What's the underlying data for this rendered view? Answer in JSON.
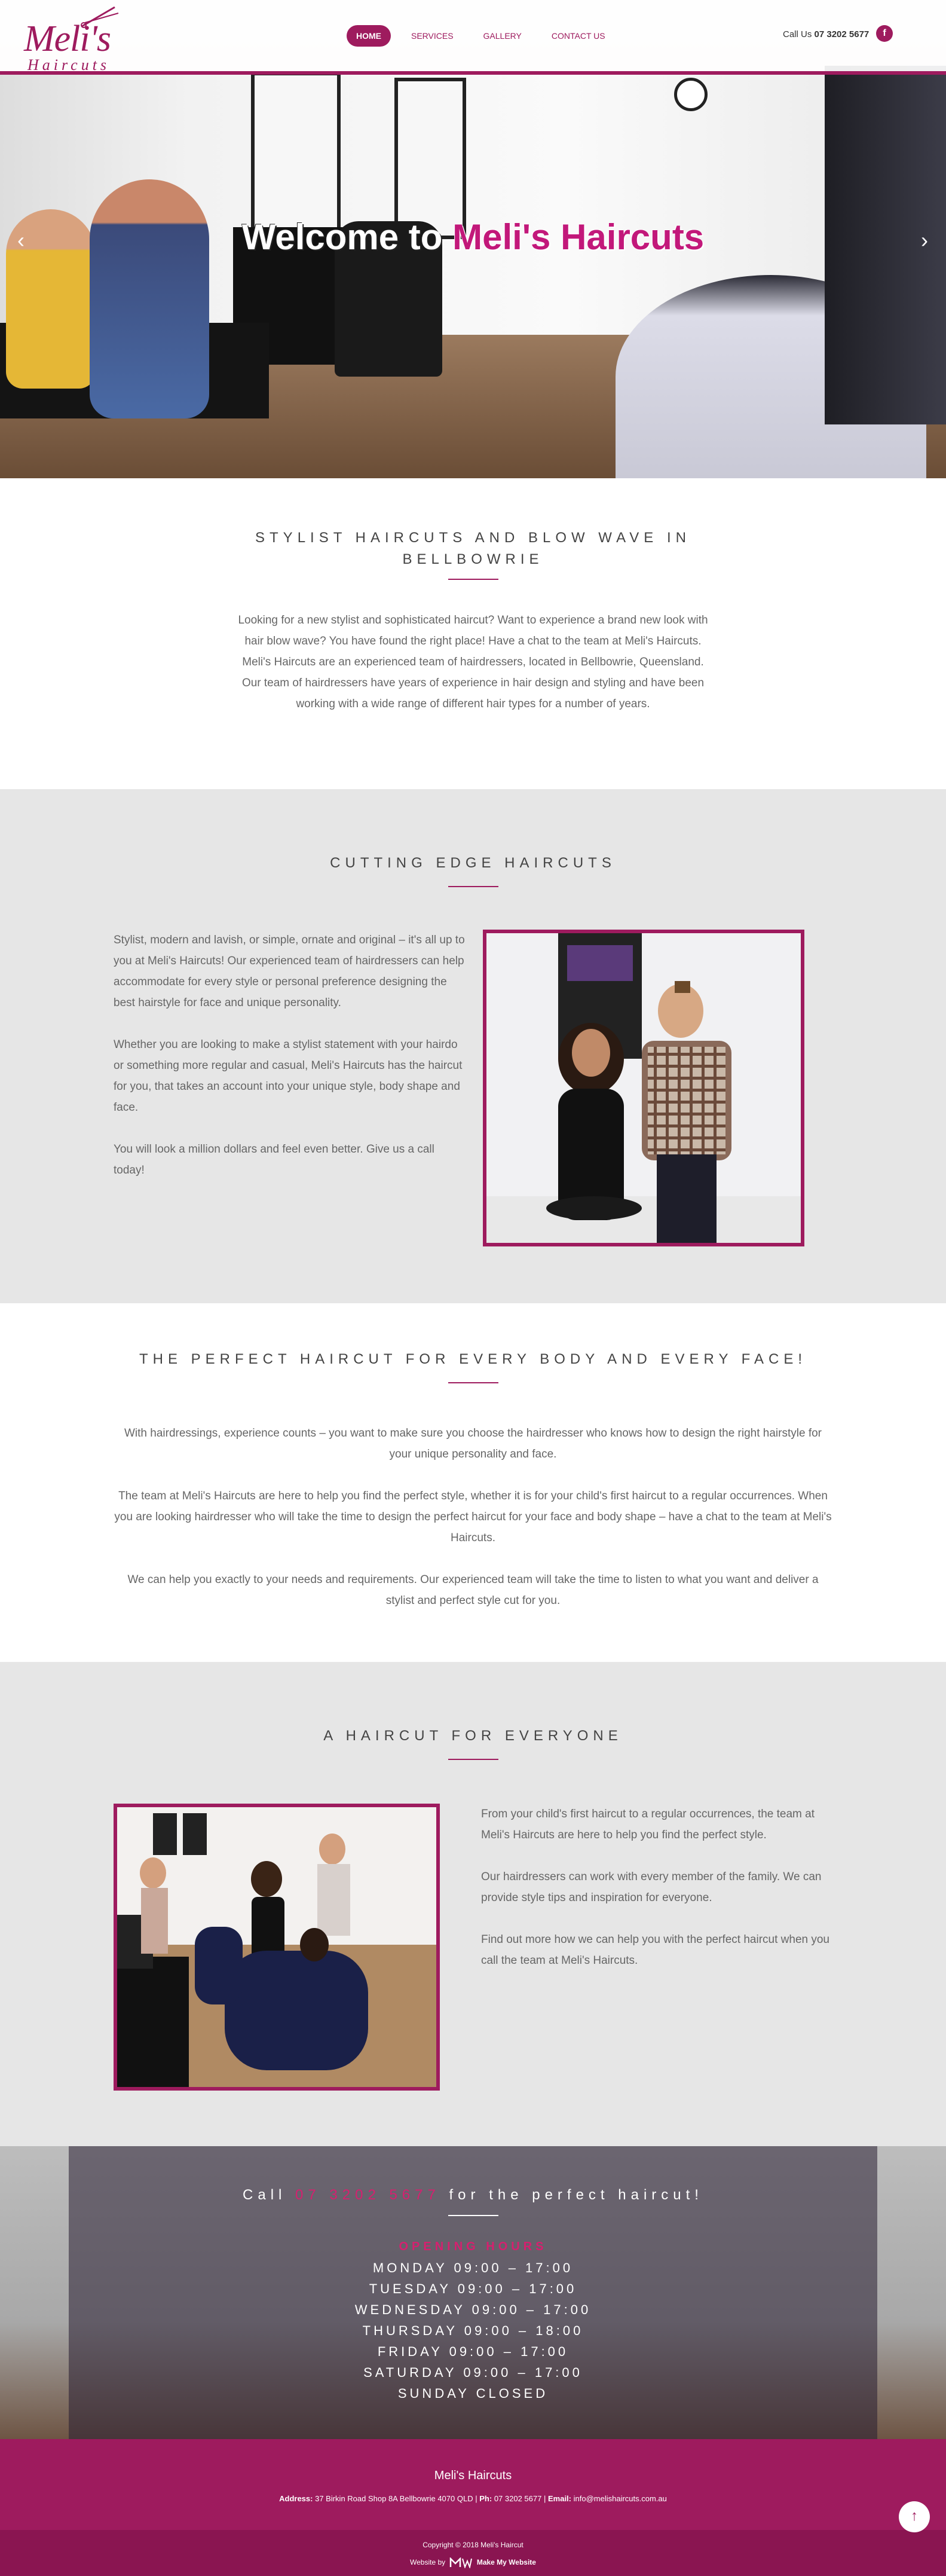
{
  "header": {
    "logo_main": "Meli's",
    "logo_sub": "Haircuts",
    "nav": [
      {
        "label": "Home",
        "active": true
      },
      {
        "label": "Services",
        "active": false
      },
      {
        "label": "Gallery",
        "active": false
      },
      {
        "label": "Contact Us",
        "active": false
      }
    ],
    "call_label": "Call Us",
    "call_number": "07 3202 5677",
    "facebook_icon": "f"
  },
  "hero": {
    "title_prefix": "Welcome to",
    "title_accent": "Meli's Haircuts",
    "prev_icon": "‹",
    "next_icon": "›"
  },
  "section_intro": {
    "title": "Stylist Haircuts and Blow Wave in Bellbowrie",
    "paragraph_1": "Looking for a new stylist and sophisticated haircut? Want to experience a brand new look with hair blow wave? You have found the right place! Have a chat to the team at Meli's Haircuts.",
    "paragraph_2": "Meli's Haircuts are an experienced team of hairdressers, located in Bellbowrie, Queensland. Our team of hairdressers have years of experience in hair design and styling and have been working with a wide range of different hair types for a number of years."
  },
  "section_cutting": {
    "title": "Cutting Edge Haircuts",
    "paragraphs": [
      "Stylist, modern and lavish, or simple, ornate and original – it's all up to you at Meli's Haircuts! Our experienced team of hairdressers can help accommodate for every style or personal preference designing the best hairstyle for face and unique personality.",
      "Whether you are looking to make a stylist statement with your hairdo or something more regular and casual, Meli's Haircuts has the haircut for you, that takes an account into your unique style, body shape and face.",
      "You will look a million dollars and feel even better. Give us a call today!"
    ]
  },
  "section_perfect": {
    "title": "The Perfect Haircut for Every Body and Every Face!",
    "paragraphs": [
      "With hairdressings, experience counts – you want to make sure you choose the hairdresser who knows how to design the right hairstyle for your unique personality and face.",
      "The team at Meli's Haircuts are here to help you find the perfect style, whether it is for your child's first haircut to a regular occurrences. When you are looking hairdresser who will take the time to design the perfect haircut for your face and body shape – have a chat to the team at Meli's Haircuts.",
      "We can help you exactly to your needs and requirements. Our experienced team will take the time to listen to what you want and deliver a stylist and perfect style cut for you."
    ]
  },
  "section_everyone": {
    "title": "A Haircut for Everyone",
    "paragraphs": [
      "From your child's first haircut to a regular occurrences, the team at Meli's Haircuts are here to help you find the perfect style.",
      "Our hairdressers can work with every member of the family. We can provide style tips and inspiration for everyone.",
      "Find out more how we can help you with the perfect haircut when you call the team at Meli's Haircuts."
    ]
  },
  "section_call": {
    "prefix": "Call",
    "phone": "07 3202 5677",
    "suffix": "for the perfect haircut!",
    "hours_title": "Opening Hours",
    "hours": [
      "Monday 09:00 – 17:00",
      "Tuesday 09:00 – 17:00",
      "Wednesday 09:00 – 17:00",
      "Thursday 09:00 – 18:00",
      "Friday 09:00 – 17:00",
      "Saturday 09:00 – 17:00",
      "Sunday Closed"
    ]
  },
  "footer": {
    "name": "Meli's Haircuts",
    "address_label": "Address:",
    "address": "37 Birkin Road Shop 8A Bellbowrie 4070 QLD",
    "phone_label": "Ph:",
    "phone": "07 3202 5677",
    "email_label": "Email:",
    "email": "info@melishaircuts.com.au",
    "copyright": "Copyright © 2018 Meli's Haircut",
    "website_by": "Website by",
    "brand": "Make My Website",
    "to_top_icon": "↑"
  },
  "colors": {
    "brand": "#9e1b5e",
    "accent_pink": "#d6206f",
    "section_grey": "#e6e6e6"
  }
}
